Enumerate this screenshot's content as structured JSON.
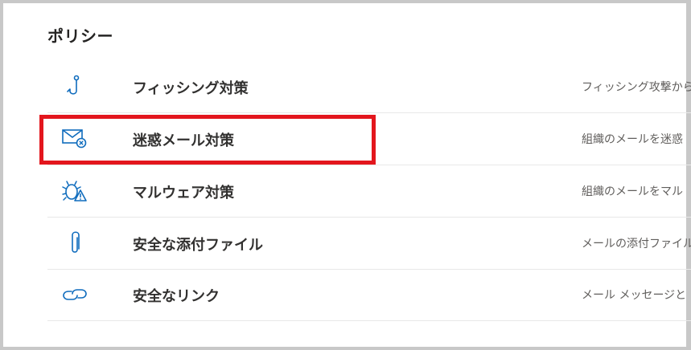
{
  "section": {
    "title": "ポリシー"
  },
  "policies": [
    {
      "label": "フィッシング対策",
      "description": "フィッシング攻撃から",
      "icon": "fishhook-icon"
    },
    {
      "label": "迷惑メール対策",
      "description": "組織のメールを迷惑",
      "icon": "mail-block-icon"
    },
    {
      "label": "マルウェア対策",
      "description": "組織のメールをマル",
      "icon": "bug-warning-icon"
    },
    {
      "label": "安全な添付ファイル",
      "description": "メールの添付ファイル",
      "icon": "paperclip-icon"
    },
    {
      "label": "安全なリンク",
      "description": "メール メッセージと",
      "icon": "link-icon"
    }
  ],
  "highlight": {
    "color": "#e3161d",
    "target": "迷惑メール対策"
  },
  "colors": {
    "icon": "#0f6cbd",
    "text": "#323130"
  }
}
